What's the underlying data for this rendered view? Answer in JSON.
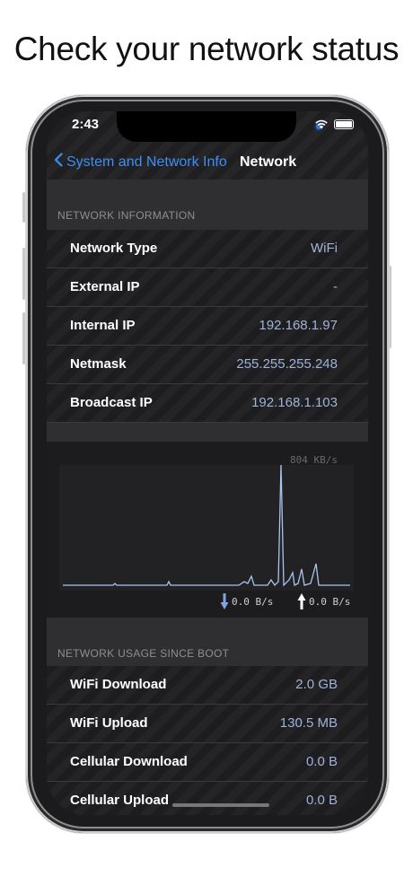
{
  "headline": "Check your network status",
  "status_bar": {
    "time": "2:43"
  },
  "nav": {
    "back_label": "System and Network Info",
    "title": "Network"
  },
  "network_info": {
    "header": "NETWORK INFORMATION",
    "rows": [
      {
        "label": "Network Type",
        "value": "WiFi"
      },
      {
        "label": "External IP",
        "value": "-"
      },
      {
        "label": "Internal IP",
        "value": "192.168.1.97"
      },
      {
        "label": "Netmask",
        "value": "255.255.255.248"
      },
      {
        "label": "Broadcast IP",
        "value": "192.168.1.103"
      }
    ]
  },
  "traffic_chart": {
    "max_label": "804 KB/s",
    "download_label": "0.0 B/s",
    "upload_label": "0.0 B/s",
    "line_color": "#a9c4ef"
  },
  "usage": {
    "header": "NETWORK USAGE SINCE BOOT",
    "rows": [
      {
        "label": "WiFi Download",
        "value": "2.0 GB"
      },
      {
        "label": "WiFi Upload",
        "value": "130.5 MB"
      },
      {
        "label": "Cellular Download",
        "value": "0.0 B"
      },
      {
        "label": "Cellular Upload",
        "value": "0.0 B"
      }
    ]
  }
}
